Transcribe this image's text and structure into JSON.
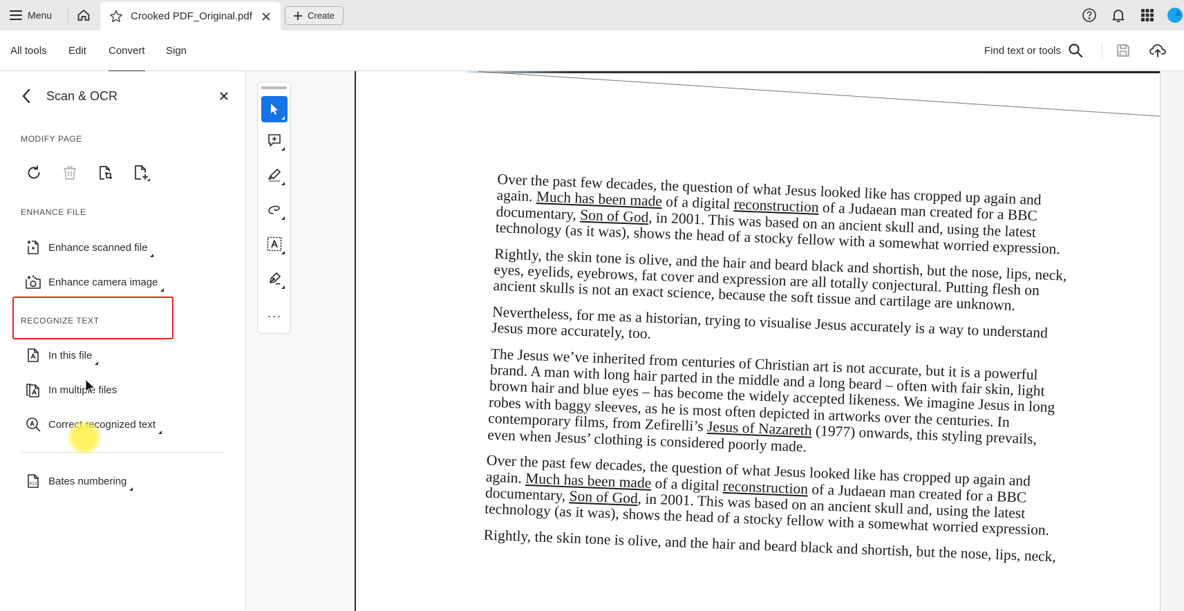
{
  "tabbar": {
    "menu_label": "Menu",
    "home_icon": "home-icon",
    "active_tab": {
      "title": "Crooked PDF_Original.pdf",
      "star_icon": "star-outline-icon",
      "close_icon": "close-icon"
    },
    "create_label": "Create",
    "right_icons": [
      "help-icon",
      "bell-icon",
      "apps-grid-icon",
      "avatar"
    ]
  },
  "toolbar": {
    "tabs": [
      {
        "label": "All tools",
        "active": false
      },
      {
        "label": "Edit",
        "active": false
      },
      {
        "label": "Convert",
        "active": true
      },
      {
        "label": "Sign",
        "active": false
      }
    ],
    "find_label": "Find text or tools",
    "icons": [
      "search-icon",
      "save-icon",
      "cloud-upload-icon"
    ]
  },
  "panel": {
    "title": "Scan & OCR",
    "sections": {
      "modify_page": {
        "label": "MODIFY PAGE",
        "icons": [
          "rotate-icon",
          "delete-icon",
          "crop-page-icon",
          "insert-page-icon"
        ]
      },
      "enhance_file": {
        "label": "ENHANCE FILE",
        "items": [
          {
            "label": "Enhance scanned file",
            "icon": "enhance-scanned-file-icon",
            "highlighted": true
          },
          {
            "label": "Enhance camera image",
            "icon": "enhance-camera-image-icon",
            "highlighted": false
          }
        ]
      },
      "recognize_text": {
        "label": "RECOGNIZE TEXT",
        "items": [
          {
            "label": "In this file",
            "icon": "ocr-file-icon"
          },
          {
            "label": "In multiple files",
            "icon": "ocr-multiple-files-icon"
          },
          {
            "label": "Correct recognized text",
            "icon": "correct-text-icon"
          }
        ]
      },
      "other": {
        "items": [
          {
            "label": "Bates numbering",
            "icon": "bates-numbering-icon"
          }
        ]
      }
    }
  },
  "rail": {
    "tools": [
      "select-tool",
      "add-comment-tool",
      "highlight-tool",
      "draw-tool",
      "text-select-tool",
      "sign-tool"
    ],
    "active": "select-tool",
    "more_label": "···"
  },
  "document": {
    "paragraphs": [
      {
        "lines": [
          [
            {
              "t": "Over the past few decades, the question of what Jesus looked like has cropped up again and"
            }
          ],
          [
            {
              "t": "again. "
            },
            {
              "t": "Much has been made",
              "u": true
            },
            {
              "t": " of a digital "
            },
            {
              "t": "reconstruction",
              "u": true
            },
            {
              "t": " of a Judaean man created for a BBC"
            }
          ],
          [
            {
              "t": "documentary, "
            },
            {
              "t": "Son of God",
              "u": true
            },
            {
              "t": ", in 2001. This was based on an ancient skull and, using the latest"
            }
          ],
          [
            {
              "t": "technology (as it was), shows the head of a stocky fellow with a somewhat worried expression."
            }
          ]
        ]
      },
      {
        "lines": [
          [
            {
              "t": "Rightly, the skin tone is olive, and the hair and beard black and shortish, but the nose, lips, neck,"
            }
          ],
          [
            {
              "t": "eyes, eyelids, eyebrows, fat cover and expression are all totally conjectural. Putting flesh on"
            }
          ],
          [
            {
              "t": "ancient skulls is not an exact science, because the soft tissue and cartilage are unknown."
            }
          ]
        ]
      },
      {
        "lines": [
          [
            {
              "t": "Nevertheless, for me as a historian, trying to visualise Jesus accurately is a way to understand"
            }
          ],
          [
            {
              "t": "Jesus more accurately, too."
            }
          ]
        ]
      },
      {
        "lines": [
          [
            {
              "t": "The Jesus we’ve inherited from centuries of Christian art is not accurate, but it is a powerful"
            }
          ],
          [
            {
              "t": "brand. A man with long hair parted in the middle and a long beard – often with fair skin, light"
            }
          ],
          [
            {
              "t": "brown hair and blue eyes – has become the widely accepted likeness. We imagine Jesus in long"
            }
          ],
          [
            {
              "t": "robes with baggy sleeves, as he is most often depicted in artworks over the centuries. In"
            }
          ],
          [
            {
              "t": "contemporary films, from Zefirelli’s "
            },
            {
              "t": "Jesus of Nazareth",
              "u": true
            },
            {
              "t": " (1977) onwards, this styling prevails,"
            }
          ],
          [
            {
              "t": "even when Jesus’ clothing is considered poorly made."
            }
          ]
        ]
      },
      {
        "lines": [
          [
            {
              "t": "Over the past few decades, the question of what Jesus looked like has cropped up again and"
            }
          ],
          [
            {
              "t": "again. "
            },
            {
              "t": "Much has been made",
              "u": true
            },
            {
              "t": " of a digital "
            },
            {
              "t": "reconstruction",
              "u": true
            },
            {
              "t": " of a Judaean man created for a BBC"
            }
          ],
          [
            {
              "t": "documentary, "
            },
            {
              "t": "Son of God",
              "u": true
            },
            {
              "t": ", in 2001. This was based on an ancient skull and, using the latest"
            }
          ],
          [
            {
              "t": "technology (as it was), shows the head of a stocky fellow with a somewhat worried expression."
            }
          ]
        ]
      },
      {
        "lines": [
          [
            {
              "t": "Rightly, the skin tone is olive, and the hair and beard black and shortish, but the nose, lips, neck,"
            }
          ]
        ]
      }
    ]
  },
  "colors": {
    "accent": "#1473e6",
    "highlight_box": "#e8231c",
    "avatar": "#1aa3ee"
  }
}
